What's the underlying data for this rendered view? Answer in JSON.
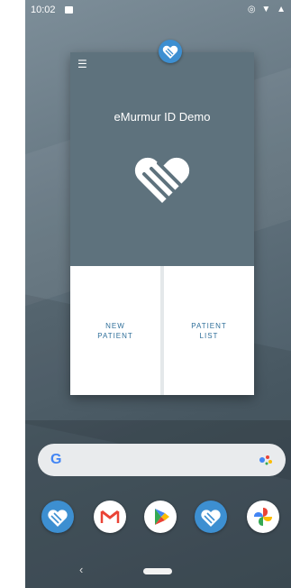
{
  "status_bar": {
    "time": "10:02",
    "right_icons": "◎ ▼ ▲"
  },
  "card": {
    "title": "eMurmur ID Demo",
    "menu_icon": "menu-icon",
    "buttons": [
      {
        "label": "NEW\nPATIENT"
      },
      {
        "label": "PATIENT\nLIST"
      }
    ]
  },
  "search": {
    "g_label": "G",
    "mic_icon": "google-assistant-icon"
  },
  "dock": {
    "apps": [
      "emurmur-app-icon",
      "gmail-icon",
      "play-store-icon",
      "emurmur-app-icon",
      "photos-icon"
    ]
  },
  "nav": {
    "back_glyph": "‹"
  },
  "colors": {
    "accent": "#3d8fd1",
    "card_bg": "#5e727d",
    "button_text": "#2f6f9a"
  }
}
